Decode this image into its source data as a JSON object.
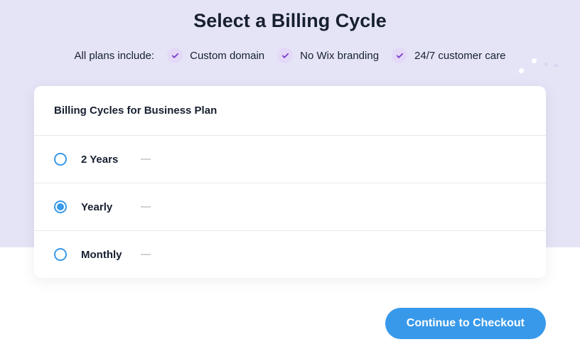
{
  "title": "Select a Billing Cycle",
  "features": {
    "label": "All plans include:",
    "items": [
      "Custom domain",
      "No Wix branding",
      "24/7 customer care"
    ]
  },
  "card": {
    "header": "Billing Cycles for Business Plan",
    "options": [
      {
        "label": "2 Years",
        "selected": false
      },
      {
        "label": "Yearly",
        "selected": true
      },
      {
        "label": "Monthly",
        "selected": false
      }
    ]
  },
  "cta": "Continue to Checkout"
}
